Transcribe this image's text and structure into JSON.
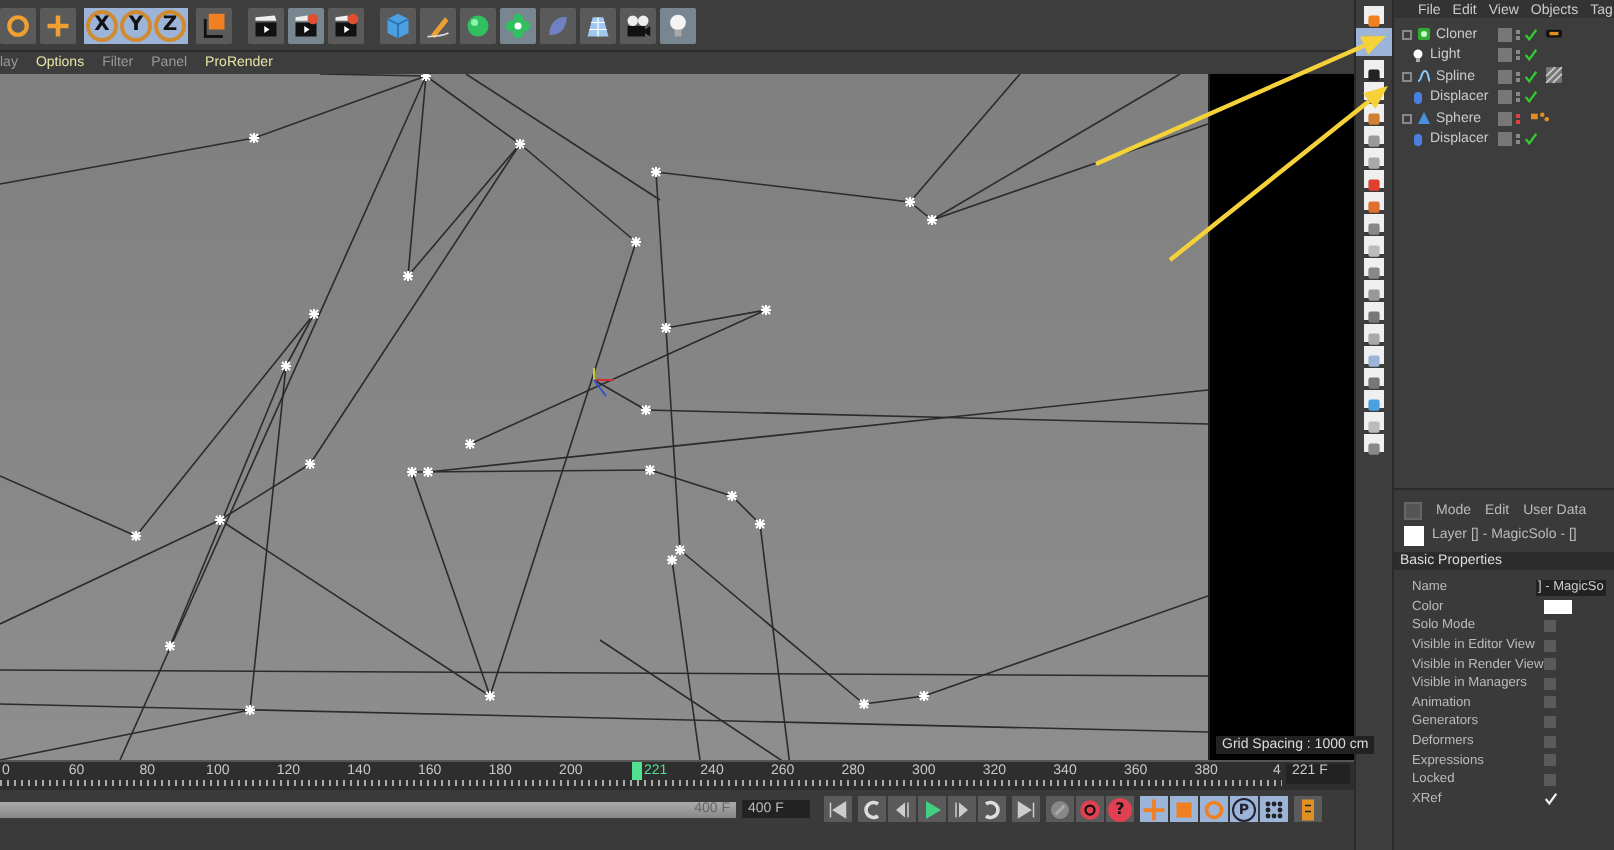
{
  "toolbar": {
    "axes": [
      "X",
      "Y",
      "Z"
    ]
  },
  "viewport": {
    "menu": [
      {
        "label": "lay",
        "highlighted": false
      },
      {
        "label": "Options",
        "highlighted": true
      },
      {
        "label": "Filter",
        "highlighted": false
      },
      {
        "label": "Panel",
        "highlighted": false
      },
      {
        "label": "ProRender",
        "highlighted": true
      }
    ],
    "grid_spacing": "Grid Spacing : 1000 cm"
  },
  "timeline": {
    "ticks": [
      "0",
      "60",
      "80",
      "100",
      "120",
      "140",
      "160",
      "180",
      "200",
      "240",
      "260",
      "280",
      "300",
      "320",
      "340",
      "360",
      "380",
      "4"
    ],
    "current_frame": "221",
    "frame_field": "221 F",
    "range": {
      "label": "400 F",
      "level": 1
    },
    "end_frame": "400 F",
    "question_button": "?",
    "p_button": "P"
  },
  "objects": {
    "menu": [
      "File",
      "Edit",
      "View",
      "Objects",
      "Tag"
    ],
    "tree": [
      {
        "name": "Cloner",
        "kind": "cloner",
        "hidden": false,
        "tag": {
          "kind": "layer"
        },
        "children": [
          {
            "name": "Light",
            "kind": "light",
            "hidden": false
          }
        ]
      },
      {
        "name": "Spline",
        "kind": "spline",
        "hidden": false,
        "tag": {
          "kind": "hatched"
        },
        "children": [
          {
            "name": "Displacer",
            "kind": "displacer",
            "hidden": false
          }
        ]
      },
      {
        "name": "Sphere",
        "kind": "sphere",
        "hidden": true,
        "tag": {
          "kind": "multi"
        },
        "children": [
          {
            "name": "Displacer",
            "kind": "displacer",
            "hidden": false
          }
        ]
      }
    ]
  },
  "attributes": {
    "menu": [
      "Mode",
      "Edit",
      "User Data"
    ],
    "title": "Layer [] - MagicSolo - []",
    "section": "Basic Properties",
    "fields": [
      {
        "label": "Name",
        "kind": "text",
        "value": "] - MagicSo"
      },
      {
        "label": "Color",
        "kind": "color"
      },
      {
        "label": "Solo Mode",
        "kind": "checkbox",
        "checked": false
      },
      {
        "label": "Visible in Editor View",
        "kind": "checkbox",
        "checked": false
      },
      {
        "label": "Visible in Render View",
        "kind": "checkbox",
        "checked": false
      },
      {
        "label": "Visible in Managers",
        "kind": "checkbox",
        "checked": false
      },
      {
        "label": "Animation",
        "kind": "checkbox",
        "checked": false
      },
      {
        "label": "Generators",
        "kind": "checkbox",
        "checked": false
      },
      {
        "label": "Deformers",
        "kind": "checkbox",
        "checked": false
      },
      {
        "label": "Expressions",
        "kind": "checkbox",
        "checked": false
      },
      {
        "label": "Locked",
        "kind": "checkbox",
        "checked": false
      },
      {
        "label": "XRef",
        "kind": "checkbox",
        "checked": true
      }
    ]
  }
}
